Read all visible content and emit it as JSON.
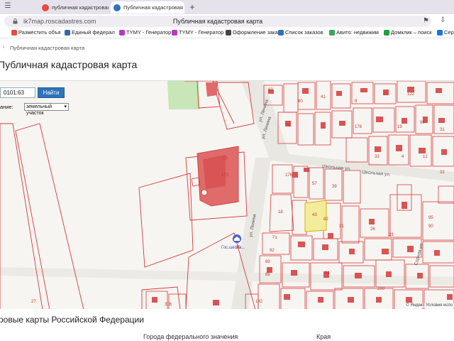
{
  "browser": {
    "tabs": [
      {
        "label": "публичная кадастровая к",
        "favicon_color": "#e74c3c"
      },
      {
        "label": "Публичная кадастровая карта",
        "favicon_color": "#2f73b9",
        "active": true
      }
    ],
    "close_symbol": "×",
    "new_tab_symbol": "+",
    "url": "ik7map.roscadastres.com",
    "page_title": "Публичная кадастровая карта"
  },
  "bookmarks": [
    {
      "label": "Разместить объя",
      "color": "#e74c3c"
    },
    {
      "label": "Единый федерал",
      "color": "#3467b0"
    },
    {
      "label": "TYMY - Генератор",
      "color": "#b63ac2"
    },
    {
      "label": "TYMY - Генератор",
      "color": "#b63ac2"
    },
    {
      "label": "Оформление зака",
      "color": "#444444"
    },
    {
      "label": "Список заказов",
      "color": "#2f73b9"
    },
    {
      "label": "Авито: недвижим",
      "color": "#34a853"
    },
    {
      "label": "Домклик – поиск",
      "color": "#21a038"
    },
    {
      "label": "Серв",
      "color": "#1a73e8"
    }
  ],
  "page": {
    "breadcrumb": "Публичная кадастровая карта",
    "title": "Публичная кадастровая карта",
    "search": {
      "value": "0101:63",
      "button": "Найти"
    },
    "type_label": "ание:",
    "type_value": "земельный участок",
    "copyright": "© Яндекс Условия испо",
    "section_heading": "ровые карты Российской Федерации",
    "columns": [
      "Города федерального значения",
      "Края"
    ]
  },
  "map": {
    "street_labels": [
      "ул. Ленина",
      "ул. Ленина",
      "Школьная ул.",
      "Школьная ул.",
      "ул. Ленина",
      "Сорная ул."
    ],
    "poi_label": "Гос.школа...",
    "parcel_numbers": [
      "63",
      "73",
      "78",
      "176",
      "18",
      "57",
      "43",
      "82",
      "21",
      "26",
      "71",
      "92",
      "89",
      "88",
      "35",
      "173",
      "34",
      "27",
      "306",
      "290",
      "95",
      "90",
      "80",
      "41",
      "39",
      "9",
      "22",
      "122",
      "142",
      "178",
      "19",
      "99",
      "23",
      "4",
      "12",
      "31",
      "33",
      "32"
    ],
    "colors": {
      "parcel_outline": "#d63a3a",
      "building_fill": "#e06b6b",
      "selected_fill": "#f3ec9a",
      "road_fill": "#e9e7e2",
      "green_area": "#c8e6b8",
      "background": "#f6f5f2"
    }
  }
}
